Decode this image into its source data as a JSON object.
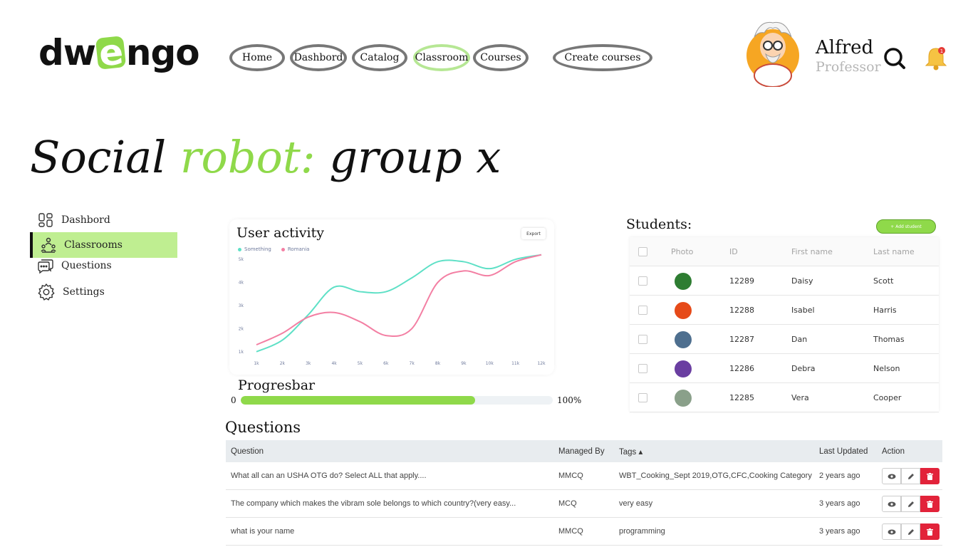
{
  "header": {
    "logo": {
      "pre": "dw",
      "accent": "e",
      "post": "ngo"
    },
    "nav": [
      "Home",
      "Dashbord",
      "Catalog",
      "Classroom",
      "Courses",
      "Create courses"
    ],
    "active_nav": "Classroom",
    "user": {
      "name": "Alfred",
      "role": "Professor"
    },
    "notification_count": "1"
  },
  "title": {
    "part1": "Social ",
    "accent": "robot:",
    "part2": " group x"
  },
  "sidebar": {
    "items": [
      {
        "label": "Dashbord",
        "icon": "dashboard-icon"
      },
      {
        "label": "Classrooms",
        "icon": "classroom-icon",
        "active": true
      },
      {
        "label": "Questions",
        "icon": "questions-icon"
      },
      {
        "label": "Settings",
        "icon": "gear-icon"
      }
    ]
  },
  "chart": {
    "title": "User activity",
    "export_label": "Export"
  },
  "chart_data": {
    "type": "line",
    "x": [
      "1k",
      "2k",
      "3k",
      "4k",
      "5k",
      "6k",
      "7k",
      "8k",
      "9k",
      "10k",
      "11k",
      "12k"
    ],
    "y_ticks": [
      "1k",
      "2k",
      "3k",
      "4k",
      "5k"
    ],
    "ylim": [
      0.5,
      5.5
    ],
    "series": [
      {
        "name": "Something",
        "color": "#5ee0c6",
        "values": [
          1.0,
          1.5,
          2.6,
          3.8,
          3.6,
          3.6,
          4.2,
          4.9,
          4.9,
          4.6,
          5.0,
          5.2
        ]
      },
      {
        "name": "Romania",
        "color": "#f37fa3",
        "values": [
          1.3,
          1.8,
          2.5,
          2.7,
          2.3,
          1.7,
          2.0,
          4.0,
          4.5,
          4.3,
          4.9,
          5.2
        ]
      }
    ],
    "legend": "top-left",
    "grid": false
  },
  "progress": {
    "label": "Progresbar",
    "min": "0",
    "max": "100%",
    "value": 0.75
  },
  "students": {
    "title": "Students:",
    "add_label": "+ Add student",
    "columns": [
      "Photo",
      "ID",
      "First name",
      "Last name"
    ],
    "rows": [
      {
        "id": "12289",
        "first": "Daisy",
        "last": "Scott",
        "photo_color": "#2e7d32"
      },
      {
        "id": "12288",
        "first": "Isabel",
        "last": "Harris",
        "photo_color": "#e64a19"
      },
      {
        "id": "12287",
        "first": "Dan",
        "last": "Thomas",
        "photo_color": "#4e6f8f"
      },
      {
        "id": "12286",
        "first": "Debra",
        "last": "Nelson",
        "photo_color": "#6a3ea1"
      },
      {
        "id": "12285",
        "first": "Vera",
        "last": "Cooper",
        "photo_color": "#8aa08a"
      }
    ]
  },
  "questions": {
    "title": "Questions",
    "columns": {
      "question": "Question",
      "managed": "Managed By",
      "tags": "Tags ▴",
      "updated": "Last Updated",
      "action": "Action"
    },
    "rows": [
      {
        "question": "What all can an USHA OTG do? Select ALL that apply....",
        "managed": "MMCQ",
        "tags": "WBT_Cooking_Sept 2019,OTG,CFC,Cooking Category",
        "updated": "2 years ago"
      },
      {
        "question": "The company which makes the vibram sole belongs to which country?(very easy...",
        "managed": "MCQ",
        "tags": "very easy",
        "updated": "3 years ago"
      },
      {
        "question": "what is your name",
        "managed": "MMCQ",
        "tags": "programming",
        "updated": "3 years ago"
      }
    ]
  }
}
